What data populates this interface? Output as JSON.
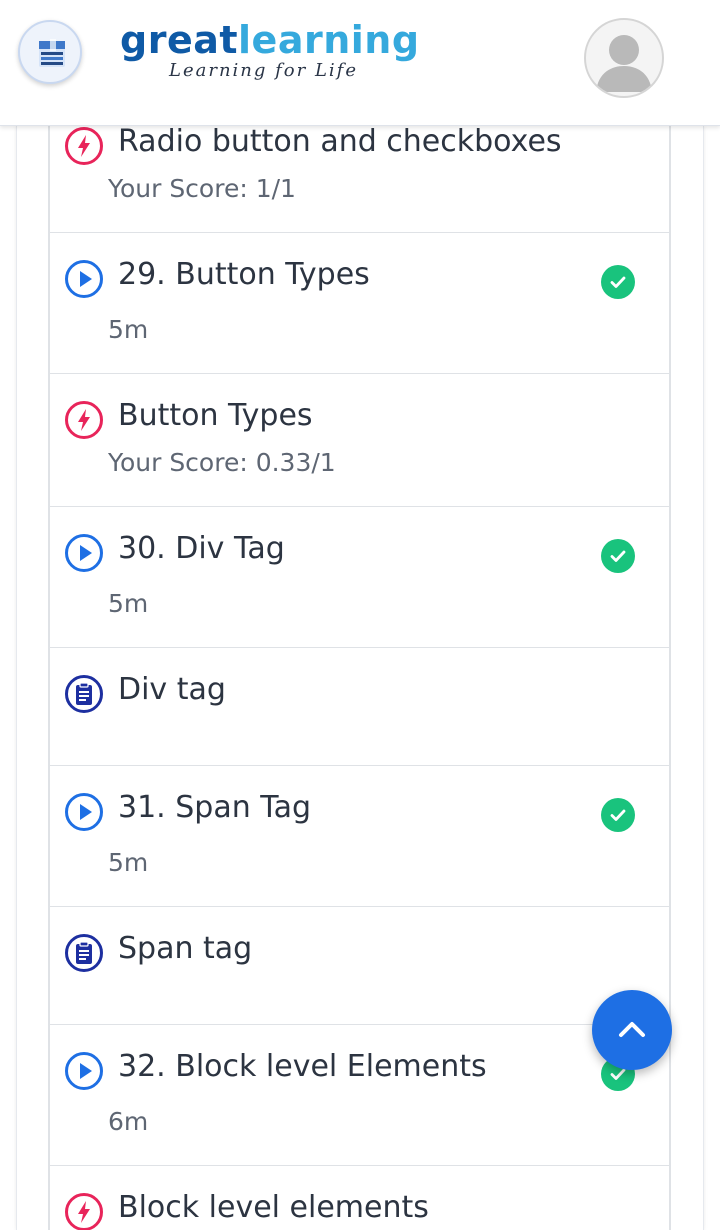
{
  "header": {
    "logo_great": "great",
    "logo_learning": "learning",
    "logo_tagline": "Learning for Life",
    "menu_icon": "menu-book-icon",
    "avatar_icon": "user-avatar-icon"
  },
  "colors": {
    "quiz": "#e8245a",
    "video": "#1e6fe4",
    "assignment": "#1d2fa0",
    "completed": "#19c37d",
    "fab": "#1e6fe4"
  },
  "items": [
    {
      "type": "quiz",
      "icon": "lightning-quiz-icon",
      "title": "Radio button and checkboxes",
      "sub": "Your Score: 1/1",
      "completed": false
    },
    {
      "type": "video",
      "icon": "play-circle-icon",
      "title": "29. Button Types",
      "sub": "5m",
      "completed": true
    },
    {
      "type": "quiz",
      "icon": "lightning-quiz-icon",
      "title": "Button Types",
      "sub": "Your Score: 0.33/1",
      "completed": false
    },
    {
      "type": "video",
      "icon": "play-circle-icon",
      "title": "30. Div Tag",
      "sub": "5m",
      "completed": true
    },
    {
      "type": "assignment",
      "icon": "clipboard-icon",
      "title": "Div tag",
      "sub": "",
      "completed": false
    },
    {
      "type": "video",
      "icon": "play-circle-icon",
      "title": "31. Span Tag",
      "sub": "5m",
      "completed": true
    },
    {
      "type": "assignment",
      "icon": "clipboard-icon",
      "title": "Span tag",
      "sub": "",
      "completed": false
    },
    {
      "type": "video",
      "icon": "play-circle-icon",
      "title": "32. Block level Elements",
      "sub": "6m",
      "completed": true
    },
    {
      "type": "quiz",
      "icon": "lightning-quiz-icon",
      "title": "Block level elements",
      "sub": "",
      "completed": false
    }
  ],
  "fab_icon": "chevron-up-icon"
}
